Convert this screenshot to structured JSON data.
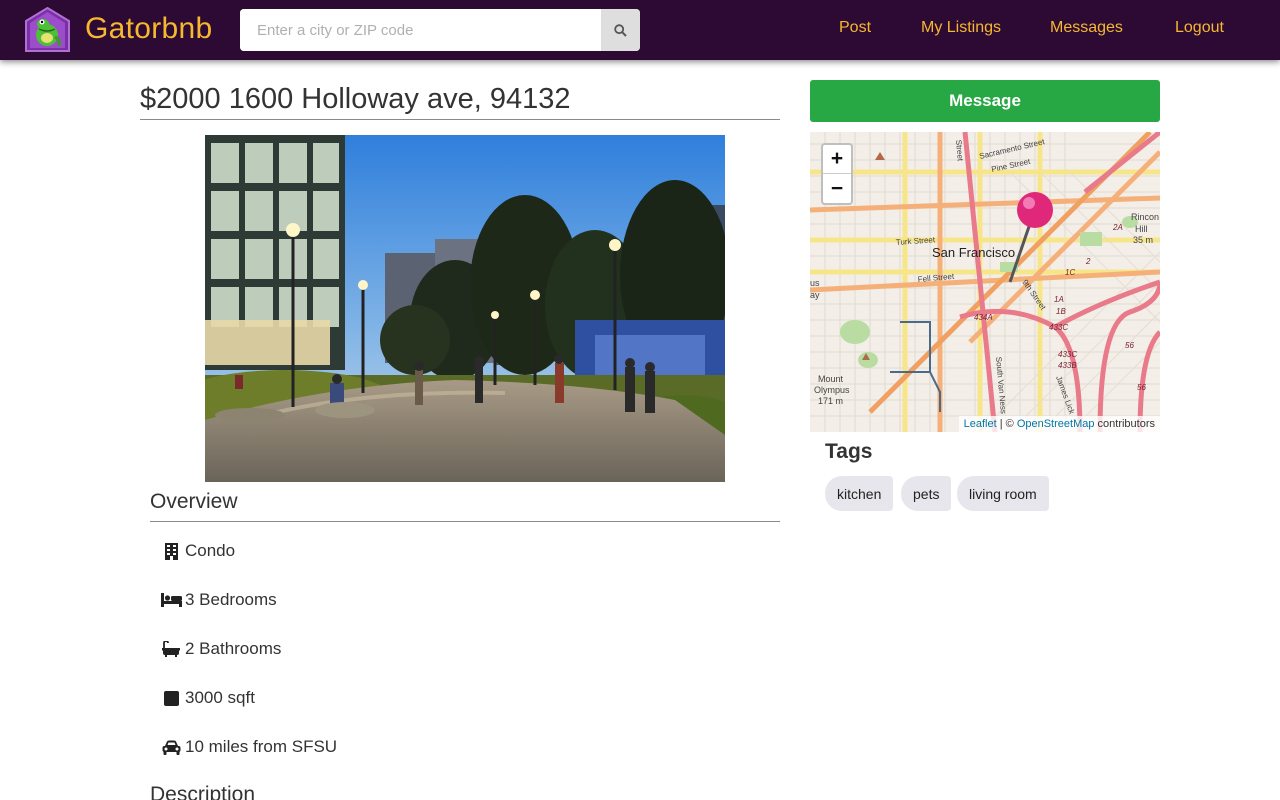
{
  "navbar": {
    "brand": "Gatorbnb",
    "search_placeholder": "Enter a city or ZIP code",
    "links": {
      "post": "Post",
      "my_listings": "My Listings",
      "messages": "Messages",
      "logout": "Logout"
    }
  },
  "listing": {
    "title": "$2000 1600 Holloway ave, 94132",
    "overview_heading": "Overview",
    "features": {
      "type": "Condo",
      "bedrooms": "3 Bedrooms",
      "bathrooms": "2 Bathrooms",
      "area": "3000 sqft",
      "distance": "10 miles from SFSU"
    },
    "description_heading": "Description"
  },
  "sidebar": {
    "message_button": "Message",
    "map": {
      "zoom_in": "+",
      "zoom_out": "−",
      "labels": {
        "city": "San Francisco",
        "sacramento": "Sacramento Street",
        "pine": "Pine Street",
        "turk": "Turk Street",
        "fell": "Fell Street",
        "ninth": "9th Street",
        "south_van_ness": "South Van Ness",
        "mount_olympus": "Mount",
        "mount_olympus2": "Olympus",
        "elev": "171 m",
        "rincon": "Rincon",
        "hill": "Hill",
        "hill_elev": "35 m",
        "r434a": "434A",
        "r433c": "433C",
        "r433b": "433B",
        "r1c": "1C",
        "r1a": "1A",
        "r1b": "1B",
        "r2": "2",
        "r2a": "2A",
        "r56": "56",
        "r56b": "56",
        "street": "Street",
        "james_lick": "James Lick",
        "us": "us",
        "ay": "ay"
      },
      "attribution_leaflet": "Leaflet",
      "attribution_sep": " | © ",
      "attribution_osm": "OpenStreetMap",
      "attribution_contrib": " contributors"
    },
    "tags_heading": "Tags",
    "tags": [
      "kitchen",
      "pets",
      "living room"
    ]
  },
  "colors": {
    "navbar_bg": "#2d0a33",
    "brand_accent": "#f5b82e",
    "message_button": "#28a745",
    "tag_bg": "#e6e6ec",
    "map_pin": "#e0287a"
  },
  "icons": {
    "logo": "gator-house-logo",
    "search": "search-icon",
    "type": "building-icon",
    "bedrooms": "bed-icon",
    "bathrooms": "bath-icon",
    "area": "square-icon",
    "distance": "car-icon",
    "map_marker": "map-pin-icon"
  }
}
